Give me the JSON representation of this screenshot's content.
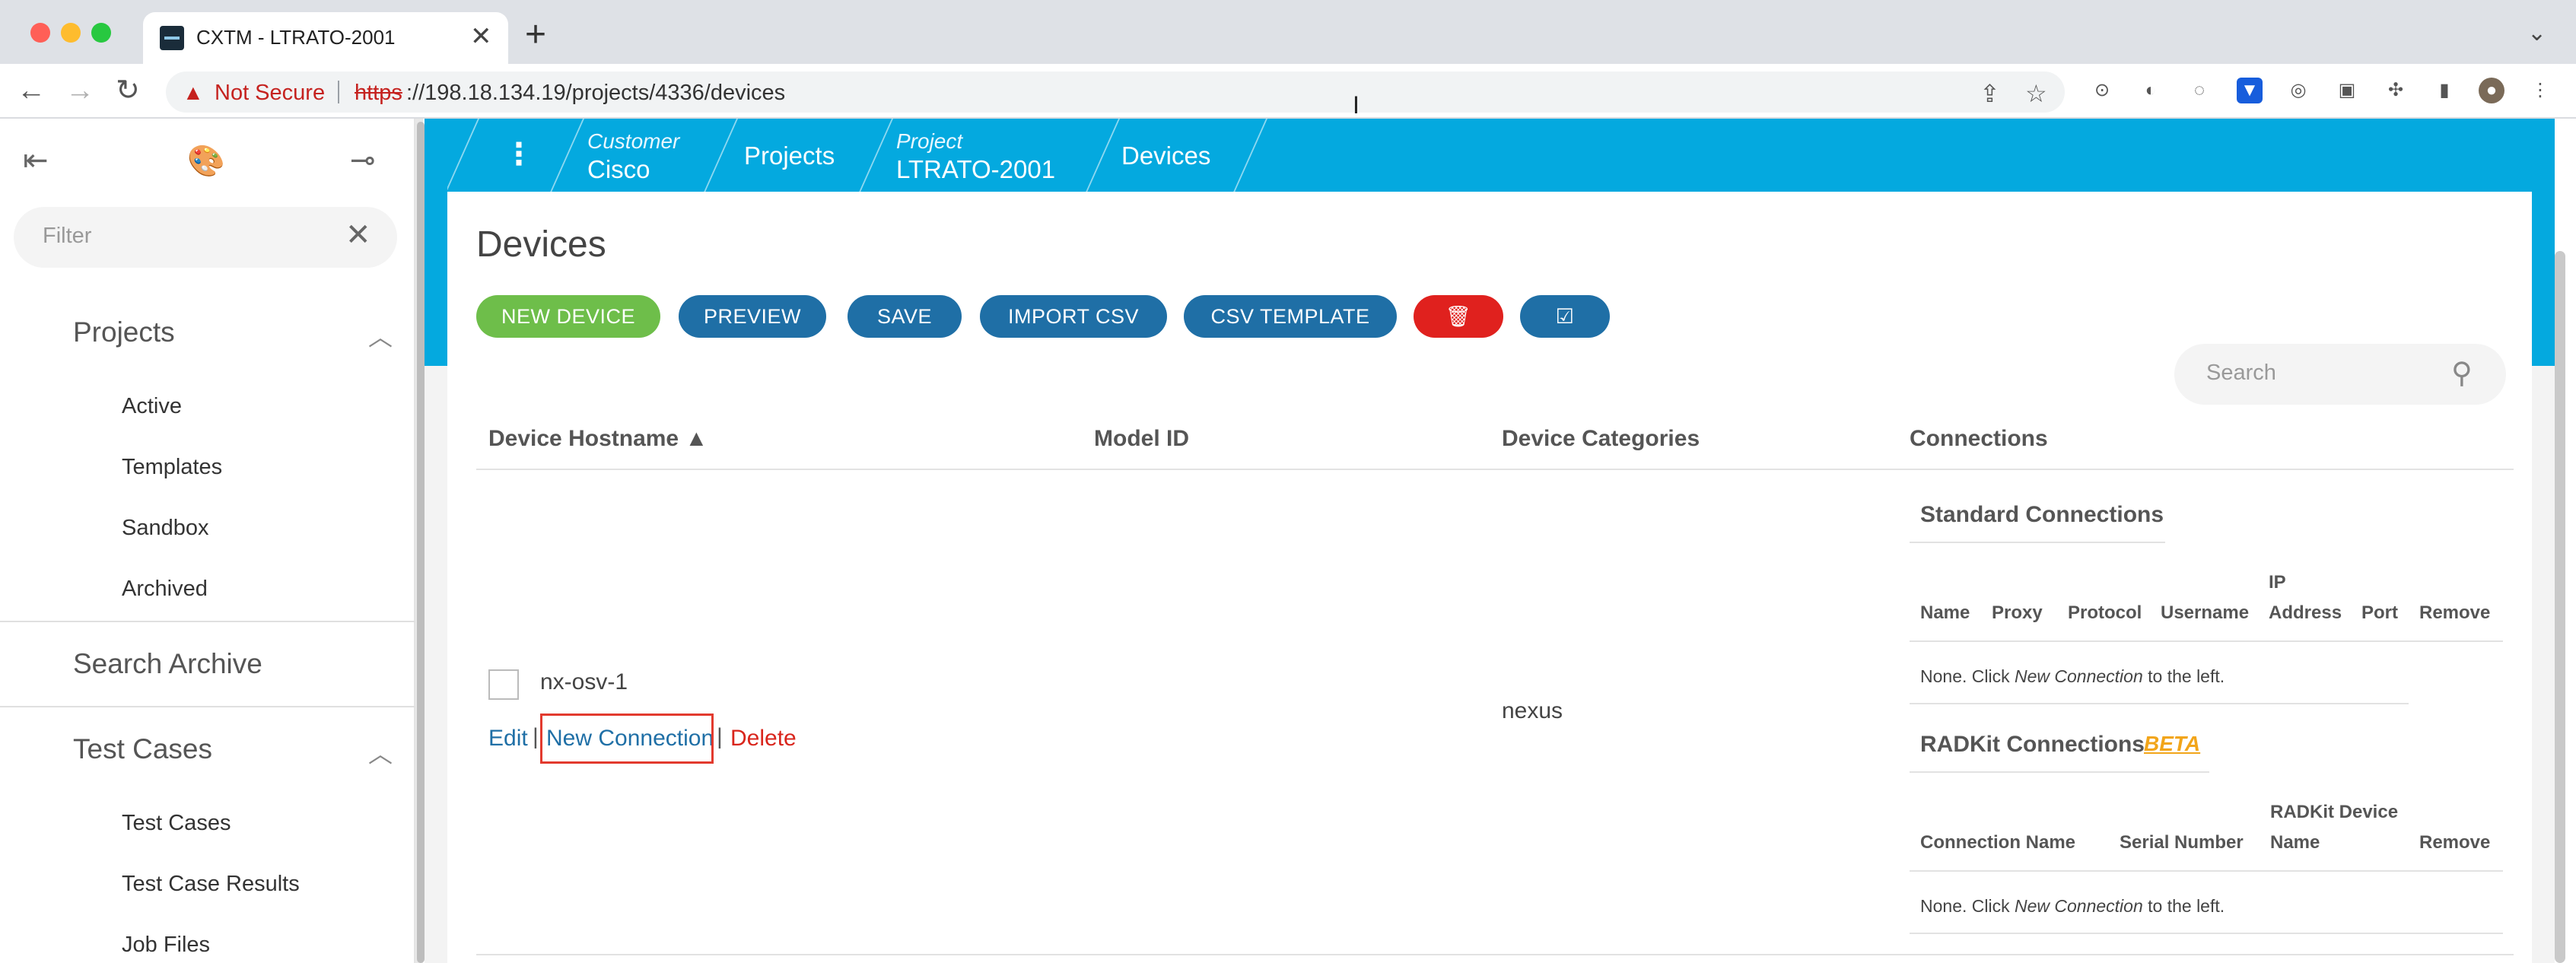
{
  "browser": {
    "tab_title": "CXTM - LTRATO-2001",
    "tab_close": "✕",
    "new_tab": "+",
    "security_label": "Not Secure",
    "url_scheme": "https",
    "url_rest": "://198.18.134.19/projects/4336/devices"
  },
  "sidebar": {
    "filter_placeholder": "Filter",
    "sections": [
      {
        "label": "Projects",
        "items": [
          "Active",
          "Templates",
          "Sandbox",
          "Archived"
        ]
      },
      {
        "label": "Search Archive"
      },
      {
        "label": "Test Cases",
        "items": [
          "Test Cases",
          "Test Case Results",
          "Job Files"
        ]
      }
    ]
  },
  "breadcrumb": {
    "customer_label": "Customer",
    "customer_value": "Cisco",
    "projects": "Projects",
    "project_label": "Project",
    "project_value": "LTRATO-2001",
    "devices": "Devices"
  },
  "page": {
    "title": "Devices",
    "buttons": {
      "new_device": "NEW DEVICE",
      "preview": "PREVIEW",
      "save": "SAVE",
      "import_csv": "IMPORT CSV",
      "csv_template": "CSV TEMPLATE"
    },
    "search_placeholder": "Search"
  },
  "table": {
    "headers": {
      "hostname": "Device Hostname ▲",
      "model": "Model ID",
      "categories": "Device Categories",
      "connections": "Connections"
    },
    "rows": [
      {
        "hostname": "nx-osv-1",
        "category": "nexus",
        "actions": {
          "edit": "Edit",
          "new_connection": "New Connection",
          "delete": "Delete",
          "separator": "|"
        }
      }
    ]
  },
  "connections": {
    "standard": {
      "title": "Standard Connections",
      "columns": [
        "Name",
        "Proxy",
        "Protocol",
        "Username",
        "IP\nAddress",
        "Port",
        "Remove"
      ],
      "empty_prefix": "None. Click ",
      "empty_link": "New Connection",
      "empty_suffix": " to the left."
    },
    "radkit": {
      "title": "RADKit Connections",
      "badge": "BETA",
      "columns": [
        "Connection Name",
        "Serial Number",
        "RADKit Device\nName",
        "Remove"
      ],
      "empty_prefix": "None. Click ",
      "empty_link": "New Connection",
      "empty_suffix": " to the left."
    }
  },
  "colors": {
    "brand_cyan": "#04a9df",
    "button_blue": "#1f6fa6",
    "button_green": "#6ebe4a",
    "button_red": "#e0211e",
    "beta_orange": "#f2a51a"
  }
}
